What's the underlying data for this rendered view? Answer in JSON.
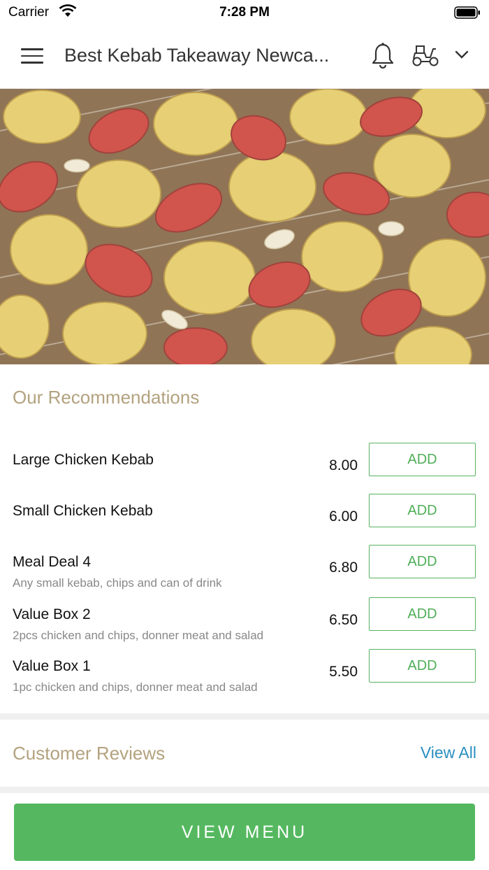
{
  "status_bar": {
    "carrier": "Carrier",
    "time": "7:28 PM"
  },
  "header": {
    "title": "Best Kebab Takeaway Newca..."
  },
  "recommendations": {
    "title": "Our Recommendations",
    "items": [
      {
        "name": "Large Chicken Kebab",
        "desc": "",
        "price": "8.00",
        "add_label": "ADD"
      },
      {
        "name": "Small Chicken Kebab",
        "desc": "",
        "price": "6.00",
        "add_label": "ADD"
      },
      {
        "name": "Meal Deal 4",
        "desc": "Any small kebab, chips and can of drink",
        "price": "6.80",
        "add_label": "ADD"
      },
      {
        "name": "Value Box 2",
        "desc": "2pcs chicken and chips, donner meat and salad",
        "price": "6.50",
        "add_label": "ADD"
      },
      {
        "name": "Value Box 1",
        "desc": "1pc chicken and chips, donner meat and salad",
        "price": "5.50",
        "add_label": "ADD"
      }
    ]
  },
  "reviews": {
    "title": "Customer Reviews",
    "view_all": "View All"
  },
  "cta": {
    "label": "VIEW MENU"
  },
  "colors": {
    "accent_green": "#55b860",
    "section_title": "#b3a27f",
    "link_blue": "#2a8fbf"
  }
}
